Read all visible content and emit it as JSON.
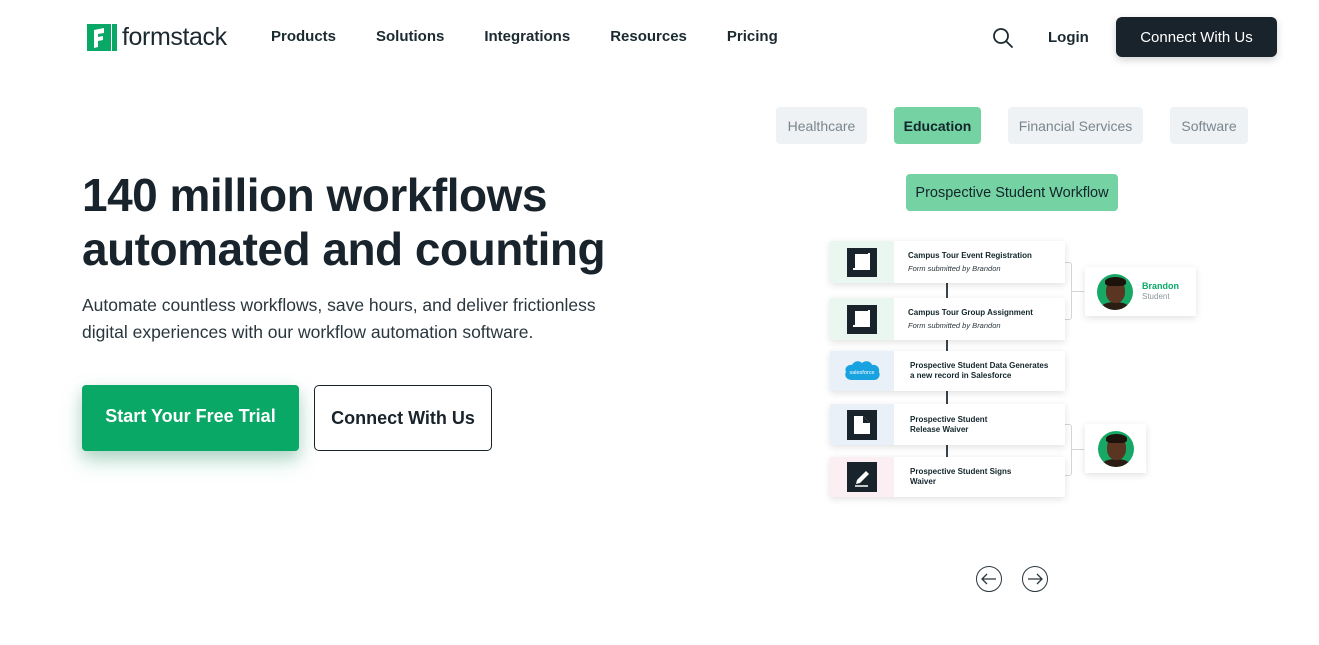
{
  "brand": {
    "name": "formstack",
    "accent": "#0aa866",
    "dark": "#18232b"
  },
  "nav": {
    "items": [
      "Products",
      "Solutions",
      "Integrations",
      "Resources",
      "Pricing"
    ],
    "search_icon": "search-icon",
    "login_label": "Login",
    "cta_label": "Connect With Us"
  },
  "hero": {
    "title": "140 million workflows automated and counting",
    "subtitle": "Automate countless workflows, save hours, and deliver frictionless digital experiences with our workflow automation software.",
    "primary_cta": "Start Your Free Trial",
    "secondary_cta": "Connect With Us"
  },
  "industry_tabs": {
    "items": [
      "Healthcare",
      "Education",
      "Financial Services",
      "Software"
    ],
    "active": "Education"
  },
  "workflow": {
    "title": "Prospective Student Workflow",
    "steps": [
      {
        "title": "Campus Tour Event Registration",
        "subtitle": "Form submitted by Brandon",
        "icon": "form-icon"
      },
      {
        "title": "Campus Tour Group Assignment",
        "subtitle": "Form submitted by Brandon",
        "icon": "form-icon"
      },
      {
        "title": "Prospective Student Data Generates\na new record in Salesforce",
        "subtitle": "",
        "icon": "salesforce-icon",
        "icon_label": "salesforce"
      },
      {
        "title": "Prospective Student\nRelease Waiver",
        "subtitle": "",
        "icon": "document-icon"
      },
      {
        "title": "Prospective Student Signs\nWaiver",
        "subtitle": "",
        "icon": "pen-icon"
      }
    ],
    "person": {
      "name": "Brandon",
      "role": "Student"
    }
  },
  "carousel": {
    "prev_icon": "arrow-left-icon",
    "next_icon": "arrow-right-icon"
  }
}
